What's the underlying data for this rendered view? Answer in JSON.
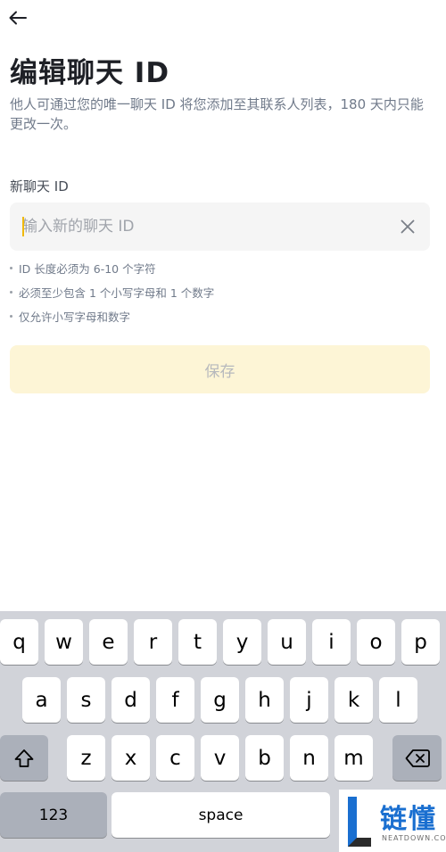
{
  "header": {
    "title": "编辑聊天 ID",
    "description": "他人可通过您的唯一聊天 ID 将您添加至其联系人列表，180 天内只能更改一次。"
  },
  "form": {
    "label": "新聊天 ID",
    "value": "",
    "placeholder": "输入新的聊天 ID",
    "rules": [
      "ID 长度必须为 6-10 个字符",
      "必须至少包含 1 个小写字母和 1 个数字",
      "仅允许小写字母和数字"
    ],
    "save_label": "保存"
  },
  "keyboard": {
    "row1": [
      "q",
      "w",
      "e",
      "r",
      "t",
      "y",
      "u",
      "i",
      "o",
      "p"
    ],
    "row2": [
      "a",
      "s",
      "d",
      "f",
      "g",
      "h",
      "j",
      "k",
      "l"
    ],
    "row3": [
      "z",
      "x",
      "c",
      "v",
      "b",
      "n",
      "m"
    ],
    "numbers_label": "123",
    "space_label": "space"
  },
  "watermark": {
    "text": "链懂",
    "subtext": "NEATDOWN.COM"
  },
  "colors": {
    "accent": "#f0b90b",
    "save_bg": "#fdf5d6",
    "input_bg": "#f5f5f5",
    "keyboard_bg": "#d1d3d9",
    "watermark_blue": "#1a6fd0"
  }
}
